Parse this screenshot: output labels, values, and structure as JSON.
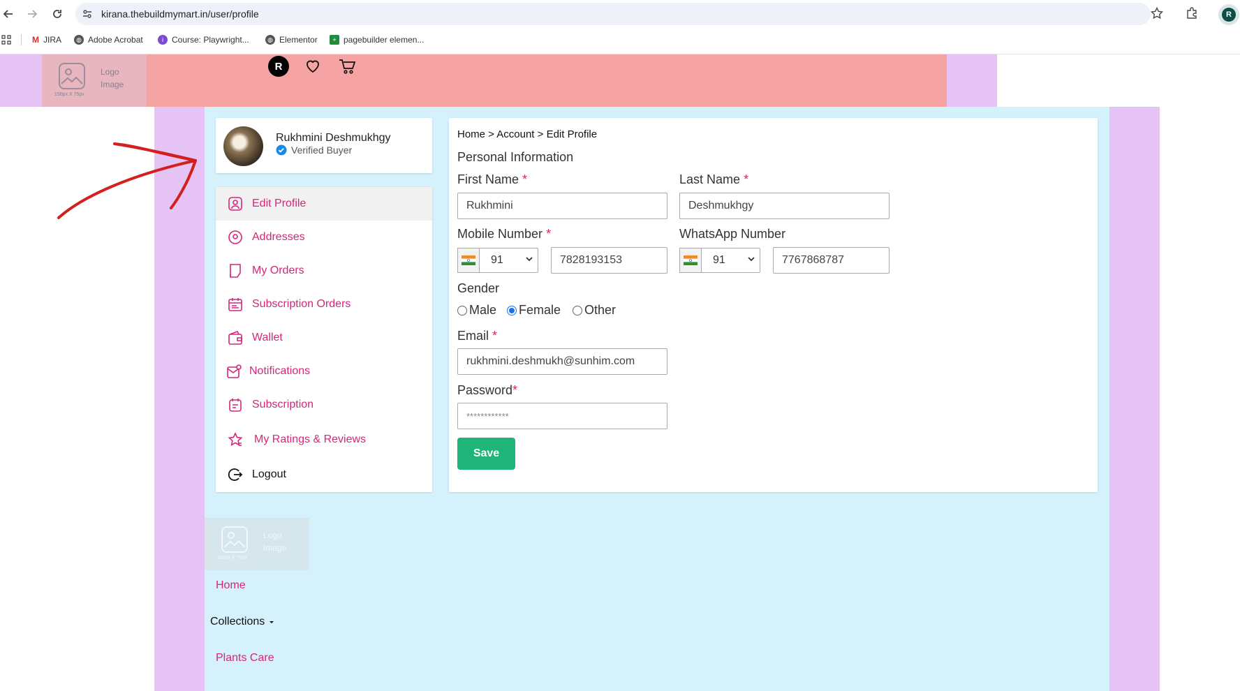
{
  "browser": {
    "url": "kirana.thebuildmymart.in/user/profile",
    "bookmarks": [
      "JIRA",
      "Adobe Acrobat",
      "Course: Playwright...",
      "Elementor",
      "pagebuilder elemen..."
    ],
    "profile_initial": "R"
  },
  "header": {
    "logo_placeholder": {
      "line1": "Logo",
      "line2": "Image",
      "size": "150px X 75px"
    },
    "avatar_initial": "R"
  },
  "profile_card": {
    "name": "Rukhmini Deshmukhgy",
    "badge": "Verified Buyer"
  },
  "menu": {
    "items": [
      {
        "label": "Edit Profile",
        "icon": "user-icon"
      },
      {
        "label": "Addresses",
        "icon": "location-pin-icon"
      },
      {
        "label": "My Orders",
        "icon": "orders-icon"
      },
      {
        "label": "Subscription Orders",
        "icon": "calendar-icon"
      },
      {
        "label": "Wallet",
        "icon": "wallet-icon"
      },
      {
        "label": "Notifications",
        "icon": "notification-icon"
      },
      {
        "label": "Subscription",
        "icon": "subscription-icon"
      },
      {
        "label": "My Ratings & Reviews",
        "icon": "star-icon"
      },
      {
        "label": "Logout",
        "icon": "logout-icon"
      }
    ]
  },
  "breadcrumb": "Home > Account > Edit Profile",
  "form": {
    "section_title": "Personal Information",
    "first_name": {
      "label": "First Name",
      "value": "Rukhmini"
    },
    "last_name": {
      "label": "Last Name",
      "value": "Deshmukhgy"
    },
    "mobile": {
      "label": "Mobile Number",
      "code": "91",
      "value": "7828193153"
    },
    "whatsapp": {
      "label": "WhatsApp Number",
      "code": "91",
      "value": "7767868787"
    },
    "gender": {
      "label": "Gender",
      "options": [
        "Male",
        "Female",
        "Other"
      ],
      "selected": "Female"
    },
    "email": {
      "label": "Email",
      "value": "rukhmini.deshmukh@sunhim.com"
    },
    "password": {
      "label": "Password",
      "value": "************"
    },
    "required_mark": "*",
    "save_label": "Save"
  },
  "footer": {
    "logo_placeholder": {
      "line1": "Logo",
      "line2": "Image",
      "size": "150px X 75px"
    },
    "links": [
      "Home",
      "Collections",
      "Plants Care"
    ]
  },
  "colors": {
    "accent": "#d6257a",
    "save": "#1fb57a",
    "header_pink": "#f5a3a3",
    "lavender": "#e6c3f5",
    "body_blue": "#d5f1fb"
  }
}
